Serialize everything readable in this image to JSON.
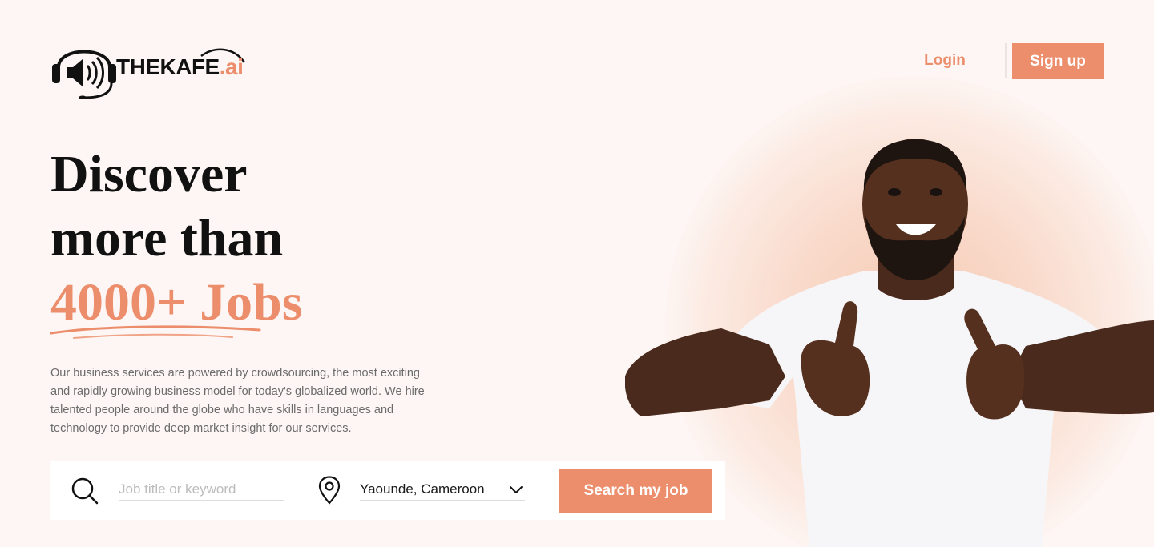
{
  "brand": {
    "wordmark": "THEKAFE",
    "suffix": ".ai",
    "accent_color": "#ec8e6c"
  },
  "header": {
    "login_label": "Login",
    "signup_label": "Sign up"
  },
  "hero": {
    "headline_line1": "Discover",
    "headline_line2": "more than",
    "headline_accent": "4000+ Jobs",
    "description": "Our business services are powered by crowdsourcing, the most exciting and rapidly growing business model for today's globalized world. We hire talented people around the globe who have skills in languages and technology to provide deep market insight for our services."
  },
  "search": {
    "keyword_placeholder": "Job title or keyword",
    "keyword_value": "",
    "location_value": "Yaounde, Cameroon",
    "button_label": "Search my job"
  },
  "icons": {
    "logo": "headset-speaker-icon",
    "search": "search-icon",
    "location": "location-pin-icon",
    "dropdown": "chevron-down-icon"
  },
  "colors": {
    "accent": "#ec8e6c",
    "background": "#fdf6f4",
    "text": "#111111",
    "muted": "#6b6b6b"
  }
}
